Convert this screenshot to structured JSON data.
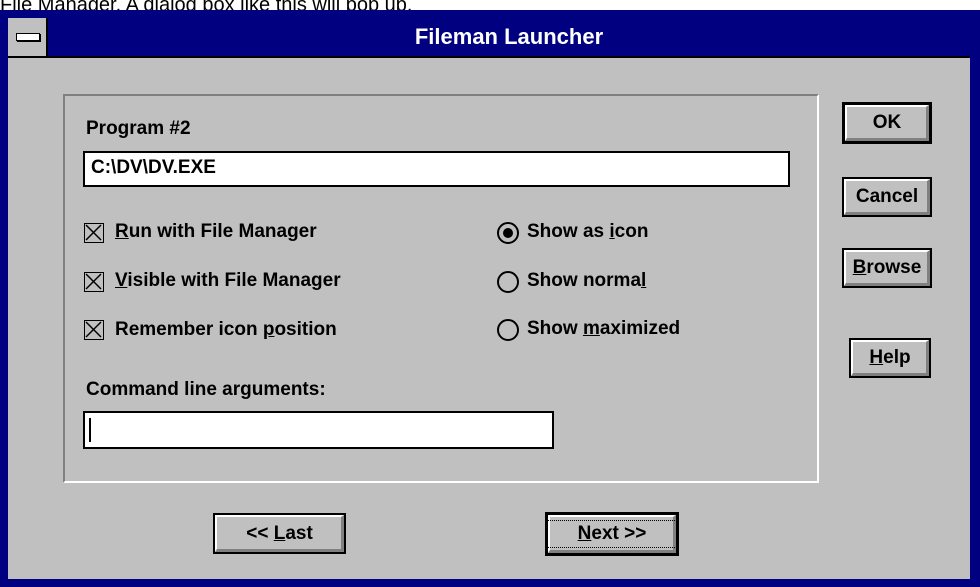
{
  "caption": "File Manager. A dialog box like this will pop up.",
  "dialog": {
    "title": "Fileman Launcher",
    "program_label": "Program #2",
    "program_path": "C:\\DV\\DV.EXE",
    "checkboxes": [
      {
        "pre": "",
        "ul": "R",
        "post": "un with File Manager",
        "checked": true
      },
      {
        "pre": "",
        "ul": "V",
        "post": "isible with File Manager",
        "checked": true
      },
      {
        "pre": "Remember icon ",
        "ul": "p",
        "post": "osition",
        "checked": true
      }
    ],
    "radios": [
      {
        "pre": "Show as ",
        "ul": "i",
        "post": "con",
        "selected": true
      },
      {
        "pre": "Show norma",
        "ul": "l",
        "post": "",
        "selected": false
      },
      {
        "pre": "Show ",
        "ul": "m",
        "post": "aximized",
        "selected": false
      }
    ],
    "args_label": "Command line arguments:",
    "args_value": "",
    "buttons": {
      "ok": "OK",
      "cancel": "Cancel",
      "browse_ul": "B",
      "browse_rest": "rowse",
      "help_ul": "H",
      "help_rest": "elp",
      "last_pre": "<< ",
      "last_ul": "L",
      "last_rest": "ast",
      "next_ul": "N",
      "next_rest": "ext >>"
    }
  }
}
